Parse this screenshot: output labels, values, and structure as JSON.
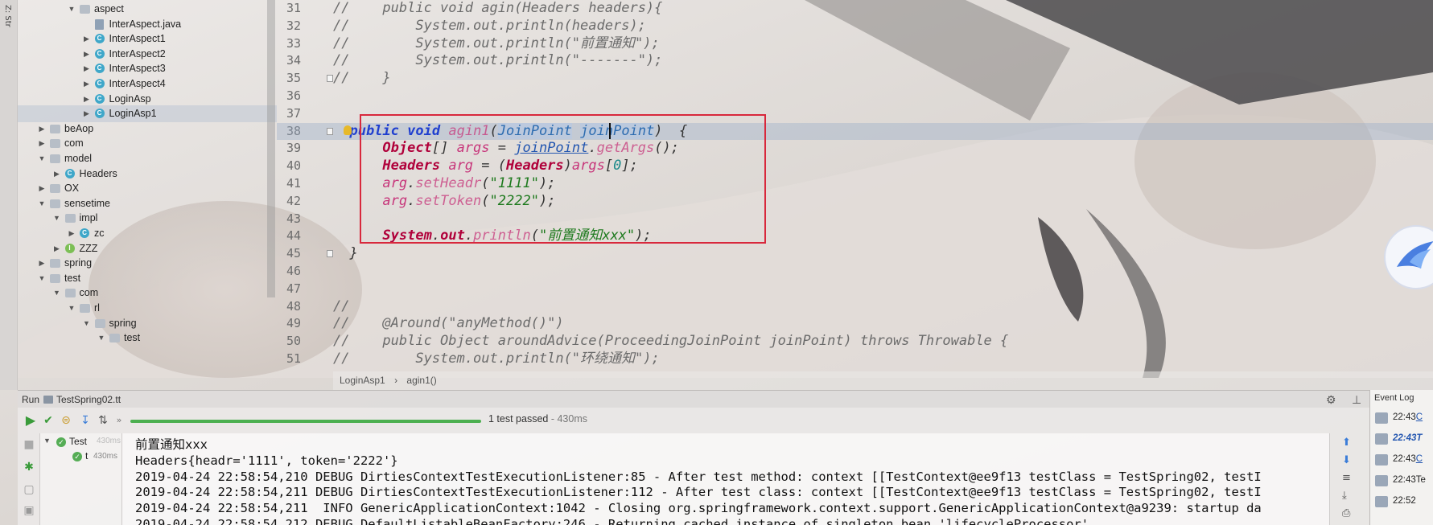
{
  "tool_strip": {
    "label": "Z: Str"
  },
  "project_tree": {
    "items": [
      {
        "label": "aspect",
        "kind": "folder",
        "depth": 5,
        "open": true
      },
      {
        "label": "InterAspect.java",
        "kind": "java",
        "depth": 6,
        "open": null
      },
      {
        "label": "InterAspect1",
        "kind": "class",
        "depth": 6,
        "open": false
      },
      {
        "label": "InterAspect2",
        "kind": "class",
        "depth": 6,
        "open": false
      },
      {
        "label": "InterAspect3",
        "kind": "class",
        "depth": 6,
        "open": false
      },
      {
        "label": "InterAspect4",
        "kind": "class",
        "depth": 6,
        "open": false
      },
      {
        "label": "LoginAsp",
        "kind": "class",
        "depth": 6,
        "open": false
      },
      {
        "label": "LoginAsp1",
        "kind": "class",
        "depth": 6,
        "open": false,
        "selected": true
      },
      {
        "label": "beAop",
        "kind": "folder",
        "depth": 3,
        "open": false
      },
      {
        "label": "com",
        "kind": "folder",
        "depth": 3,
        "open": false
      },
      {
        "label": "model",
        "kind": "folder",
        "depth": 3,
        "open": true
      },
      {
        "label": "Headers",
        "kind": "class",
        "depth": 4,
        "open": false
      },
      {
        "label": "OX",
        "kind": "folder",
        "depth": 3,
        "open": false
      },
      {
        "label": "sensetime",
        "kind": "folder",
        "depth": 3,
        "open": true
      },
      {
        "label": "impl",
        "kind": "folder",
        "depth": 4,
        "open": true
      },
      {
        "label": "zc",
        "kind": "class",
        "depth": 5,
        "open": false
      },
      {
        "label": "ZZZ",
        "kind": "iface",
        "depth": 4,
        "open": false
      },
      {
        "label": "spring",
        "kind": "folder",
        "depth": 3,
        "open": false
      },
      {
        "label": "test",
        "kind": "folder",
        "depth": 3,
        "open": true
      },
      {
        "label": "com",
        "kind": "folder",
        "depth": 4,
        "open": true
      },
      {
        "label": "rl",
        "kind": "folder",
        "depth": 5,
        "open": true
      },
      {
        "label": "spring",
        "kind": "folder",
        "depth": 6,
        "open": true
      },
      {
        "label": "test",
        "kind": "folder",
        "depth": 7,
        "open": true
      }
    ]
  },
  "editor": {
    "lines": [
      {
        "no": "31",
        "tokens": [
          [
            "cm",
            "//    public void agin(Headers headers){"
          ]
        ]
      },
      {
        "no": "32",
        "tokens": [
          [
            "cm",
            "//        System.out.println(headers);"
          ]
        ]
      },
      {
        "no": "33",
        "tokens": [
          [
            "cm",
            "//        System.out.println(\"前置通知\");"
          ]
        ]
      },
      {
        "no": "34",
        "tokens": [
          [
            "cm",
            "//        System.out.println(\"-------\");"
          ]
        ]
      },
      {
        "no": "35",
        "tokens": [
          [
            "cm",
            "//    }"
          ]
        ]
      },
      {
        "no": "36",
        "tokens": []
      },
      {
        "no": "37",
        "tokens": []
      },
      {
        "no": "38",
        "hl": true,
        "tokens": [
          [
            "pl",
            "  "
          ],
          [
            "kw",
            "public"
          ],
          [
            "pl",
            " "
          ],
          [
            "kw",
            "void"
          ],
          [
            "pl",
            " "
          ],
          [
            "fn",
            "agin1"
          ],
          [
            "pl",
            "("
          ],
          [
            "ps",
            "JoinPoint"
          ],
          [
            "pl",
            " "
          ],
          [
            "ps",
            "joinPoint"
          ],
          [
            "pl",
            ")  {"
          ]
        ]
      },
      {
        "no": "39",
        "tokens": [
          [
            "pl",
            "      "
          ],
          [
            "ty",
            "Object"
          ],
          [
            "pl",
            "[] "
          ],
          [
            "vr",
            "args"
          ],
          [
            "pl",
            " = "
          ],
          [
            "pr",
            "joinPoint"
          ],
          [
            "pl",
            "."
          ],
          [
            "fn",
            "getArgs"
          ],
          [
            "pl",
            "();"
          ]
        ]
      },
      {
        "no": "40",
        "tokens": [
          [
            "pl",
            "      "
          ],
          [
            "ty",
            "Headers"
          ],
          [
            "pl",
            " "
          ],
          [
            "vr",
            "arg"
          ],
          [
            "pl",
            " = ("
          ],
          [
            "ty",
            "Headers"
          ],
          [
            "pl",
            ")"
          ],
          [
            "vr",
            "args"
          ],
          [
            "pl",
            "["
          ],
          [
            "nm",
            "0"
          ],
          [
            "pl",
            "];"
          ]
        ]
      },
      {
        "no": "41",
        "tokens": [
          [
            "pl",
            "      "
          ],
          [
            "vr",
            "arg"
          ],
          [
            "pl",
            "."
          ],
          [
            "fn",
            "setHeadr"
          ],
          [
            "pl",
            "("
          ],
          [
            "st",
            "\"1111\""
          ],
          [
            "pl",
            ");"
          ]
        ]
      },
      {
        "no": "42",
        "tokens": [
          [
            "pl",
            "      "
          ],
          [
            "vr",
            "arg"
          ],
          [
            "pl",
            "."
          ],
          [
            "fn",
            "setToken"
          ],
          [
            "pl",
            "("
          ],
          [
            "st",
            "\"2222\""
          ],
          [
            "pl",
            ");"
          ]
        ]
      },
      {
        "no": "43",
        "tokens": []
      },
      {
        "no": "44",
        "tokens": [
          [
            "pl",
            "      "
          ],
          [
            "ty",
            "System"
          ],
          [
            "pl",
            "."
          ],
          [
            "ty",
            "out"
          ],
          [
            "pl",
            "."
          ],
          [
            "fn",
            "println"
          ],
          [
            "pl",
            "("
          ],
          [
            "st",
            "\"前置通知xxx\""
          ],
          [
            "pl",
            ");"
          ]
        ]
      },
      {
        "no": "45",
        "tokens": [
          [
            "pl",
            "  }"
          ]
        ]
      },
      {
        "no": "46",
        "tokens": []
      },
      {
        "no": "47",
        "tokens": []
      },
      {
        "no": "48",
        "tokens": [
          [
            "cm",
            "//"
          ]
        ]
      },
      {
        "no": "49",
        "tokens": [
          [
            "cm",
            "//    @Around(\"anyMethod()\")"
          ]
        ]
      },
      {
        "no": "50",
        "tokens": [
          [
            "cm",
            "//    public Object aroundAdvice(ProceedingJoinPoint joinPoint) throws Throwable {"
          ]
        ]
      },
      {
        "no": "51",
        "tokens": [
          [
            "cm",
            "//        System.out.println(\"环绕通知\");"
          ]
        ]
      }
    ]
  },
  "breadcrumb": {
    "class": "LoginAsp1",
    "separator": "›",
    "method": "agin1()"
  },
  "run_window": {
    "title": "Run",
    "config": "TestSpring02.tt",
    "status": "1 test passed",
    "duration": " - 430ms",
    "progress": 1.0,
    "tree": {
      "root": "Test",
      "root_time": "430ms",
      "child": "t",
      "child_time": "430ms"
    },
    "console": [
      "前置通知xxx",
      "Headers{headr='1111', token='2222'}",
      "2019-04-24 22:58:54,210 DEBUG DirtiesContextTestExecutionListener:85 - After test method: context [[TestContext@ee9f13 testClass = TestSpring02, testI",
      "2019-04-24 22:58:54,211 DEBUG DirtiesContextTestExecutionListener:112 - After test class: context [[TestContext@ee9f13 testClass = TestSpring02, testI",
      "2019-04-24 22:58:54,211  INFO GenericApplicationContext:1042 - Closing org.springframework.context.support.GenericApplicationContext@a9239: startup da",
      "2019-04-24 22:58:54,212 DEBUG DefaultListableBeanFactory:246 - Returning cached instance of singleton bean 'lifecycleProcessor'"
    ]
  },
  "event_log": {
    "title": "Event Log",
    "entries": [
      {
        "time": "22:43",
        "link": "C",
        "style": "link"
      },
      {
        "time": "22:43T",
        "link": "",
        "style": "italic"
      },
      {
        "time": "22:43",
        "link": "C",
        "style": "link"
      },
      {
        "time": "22:43Te",
        "link": "",
        "style": "plain"
      },
      {
        "time": "22:52",
        "link": "",
        "style": "plain"
      }
    ]
  },
  "colors": {
    "highlight_box": "#d8283c",
    "progress": "#4caf50",
    "keyword": "#1f3fcf"
  }
}
